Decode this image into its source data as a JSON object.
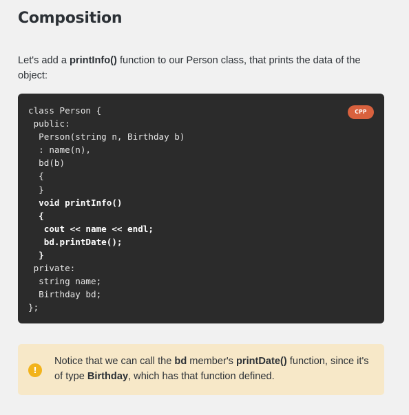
{
  "section": {
    "title": "Composition"
  },
  "intro": {
    "prefix": "Let's add a ",
    "function_name": "printInfo()",
    "suffix": " function to our Person class, that prints the data of the object:"
  },
  "code": {
    "language_badge": "CPP",
    "lines": [
      "class Person {",
      " public:",
      "  Person(string n, Birthday b)",
      "  : name(n),",
      "  bd(b)",
      "  {",
      "  }",
      "  void printInfo()",
      "  {",
      "   cout << name << endl;",
      "   bd.printDate();",
      "  }",
      " private:",
      "  string name;",
      "  Birthday bd;",
      "};"
    ],
    "highlighted_lines": [
      7,
      8,
      9,
      10,
      11
    ]
  },
  "notice": {
    "icon": "exclamation-icon",
    "icon_glyph": "!",
    "part1": "Notice that we can call the ",
    "member": "bd",
    "part2": " member's ",
    "function_name": "printDate()",
    "part3": " function, since it's of type ",
    "type_name": "Birthday",
    "part4": ", which has that function defined."
  },
  "colors": {
    "page_background": "#f1f1f1",
    "code_background": "#2b2b2b",
    "badge": "#d8613e",
    "notice_background": "#f7e8c8",
    "notice_icon": "#f2b31b"
  }
}
